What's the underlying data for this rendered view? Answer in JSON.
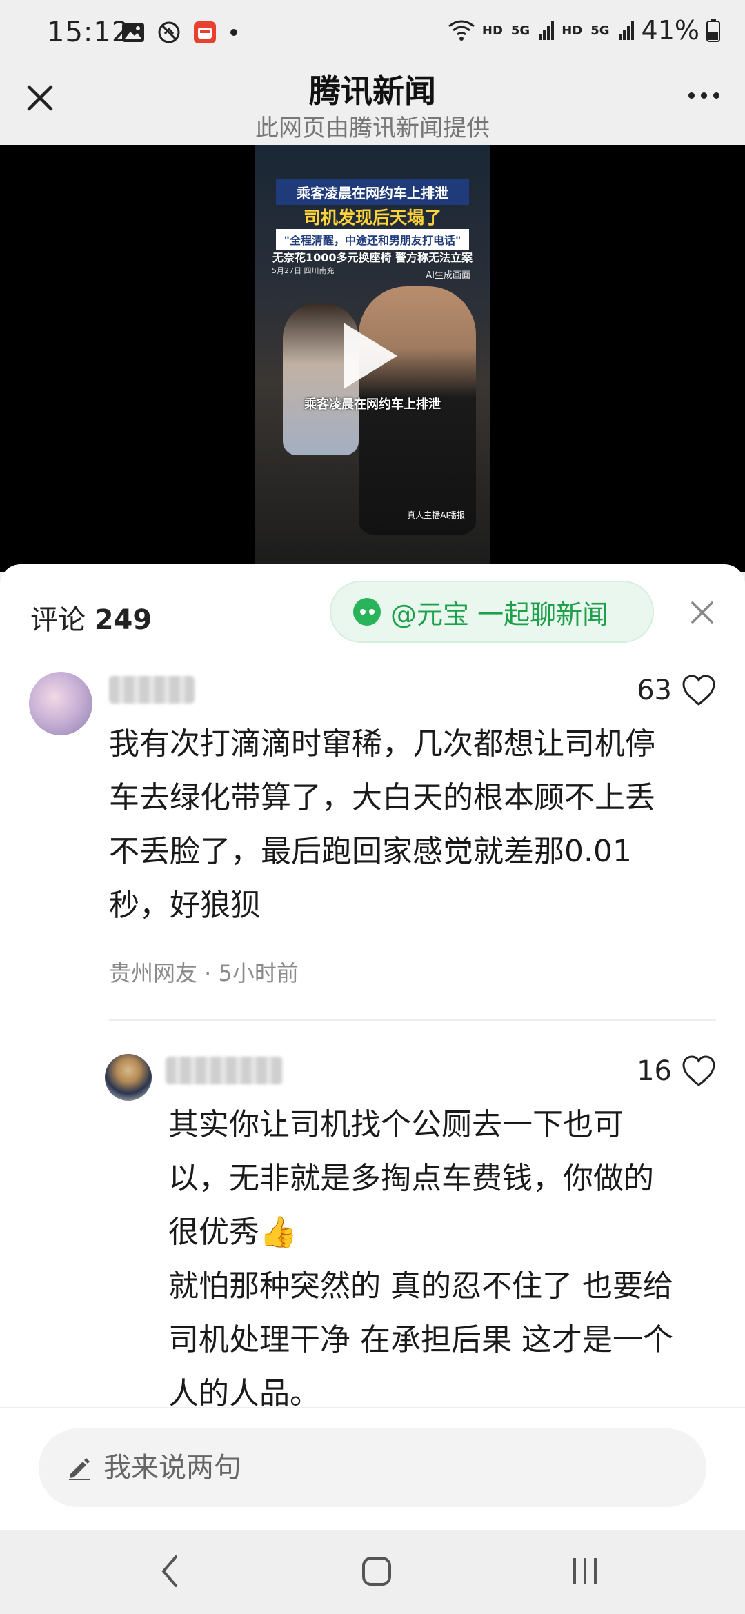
{
  "status_bar": {
    "time": "15:12",
    "icons": [
      "image-icon",
      "no-disturb-icon",
      "app-badge-icon",
      "dot-icon"
    ],
    "network_tags": [
      "HD",
      "5G",
      "HD",
      "5G"
    ],
    "battery": "41%"
  },
  "title_bar": {
    "title": "腾讯新闻",
    "subtitle": "此网页由腾讯新闻提供"
  },
  "video": {
    "headline_1": "乘客凌晨在网约车上排泄",
    "headline_2": "司机发现后天塌了",
    "headline_3": "\"全程清醒，中途还和男朋友打电话\"",
    "headline_4": "无奈花1000多元换座椅 警方称无法立案",
    "date_location": "5月27日 四川南充",
    "ai_tag": "AI生成画面",
    "caption": "乘客凌晨在网约车上排泄",
    "bottom_tag": "真人主播AI播报"
  },
  "comments_sheet": {
    "label": "评论",
    "count": "249",
    "yuanbao_button": "@元宝 一起聊新闻",
    "comments": [
      {
        "likes": "63",
        "text": "我有次打滴滴时窜稀，几次都想让司机停车去绿化带算了，大白天的根本顾不上丢不丢脸了，最后跑回家感觉就差那0.01秒，好狼狈",
        "meta": "贵州网友 · 5小时前"
      },
      {
        "likes": "16",
        "text": "其实你让司机找个公厕去一下也可以，无非就是多掏点车费钱，你做的很优秀👍\n就怕那种突然的 真的忍不住了 也要给司机处理干净 在承担后果 这才是一个人的人品。"
      }
    ]
  },
  "input": {
    "placeholder": "我来说两句"
  },
  "colors": {
    "accent_green": "#1ea04b",
    "text_dark": "#1a1a1a",
    "meta_gray": "#8a8a8a"
  }
}
